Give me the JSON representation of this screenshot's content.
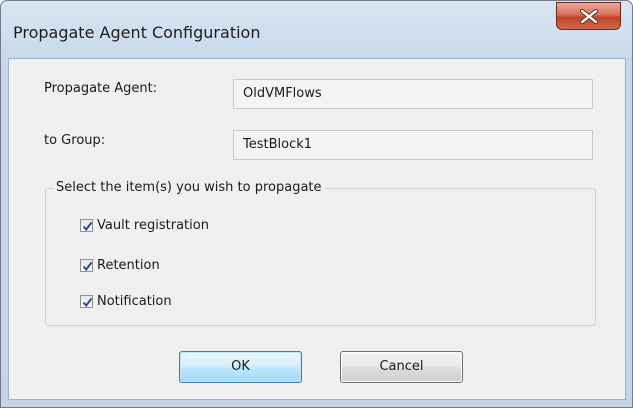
{
  "window": {
    "title": "Propagate Agent Configuration",
    "close_icon": "close-icon"
  },
  "form": {
    "agent_label": "Propagate Agent:",
    "agent_value": "OldVMFlows",
    "group_label": "to Group:",
    "group_value": "TestBlock1"
  },
  "propagate_group": {
    "legend": "Select the item(s) you wish to propagate",
    "items": [
      {
        "label": "Vault registration",
        "checked": true
      },
      {
        "label": "Retention",
        "checked": true
      },
      {
        "label": "Notification",
        "checked": true
      }
    ]
  },
  "buttons": {
    "ok_label": "OK",
    "cancel_label": "Cancel"
  },
  "colors": {
    "close_button": "#c75d47",
    "ok_border": "#3c7fb1",
    "checkmark": "#2c4a9a"
  }
}
